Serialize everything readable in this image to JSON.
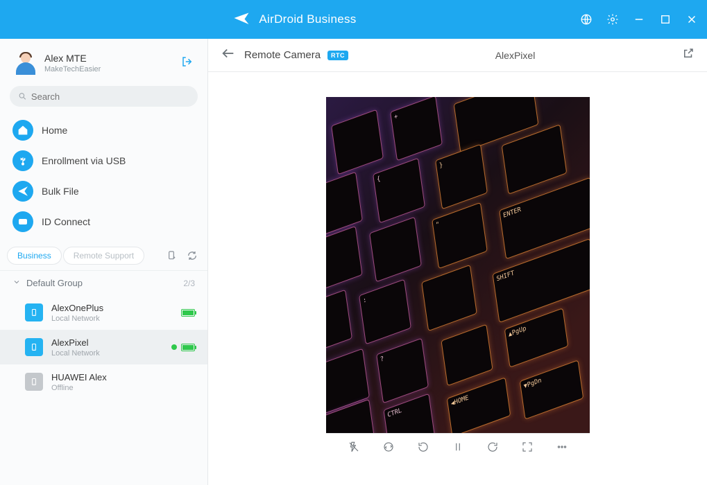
{
  "app": {
    "title": "AirDroid Business"
  },
  "user": {
    "name": "Alex MTE",
    "subtitle": "MakeTechEasier"
  },
  "search": {
    "placeholder": "Search"
  },
  "nav": {
    "home": "Home",
    "enroll": "Enrollment via USB",
    "bulk": "Bulk File",
    "idconnect": "ID Connect"
  },
  "tabs": {
    "business": "Business",
    "remote": "Remote Support"
  },
  "group": {
    "name": "Default Group",
    "count": "2/3"
  },
  "devices": [
    {
      "name": "AlexOnePlus",
      "status": "Local Network"
    },
    {
      "name": "AlexPixel",
      "status": "Local Network"
    },
    {
      "name": "HUAWEI Alex",
      "status": "Offline"
    }
  ],
  "main": {
    "title": "Remote Camera",
    "badge": "RTC",
    "device": "AlexPixel"
  }
}
